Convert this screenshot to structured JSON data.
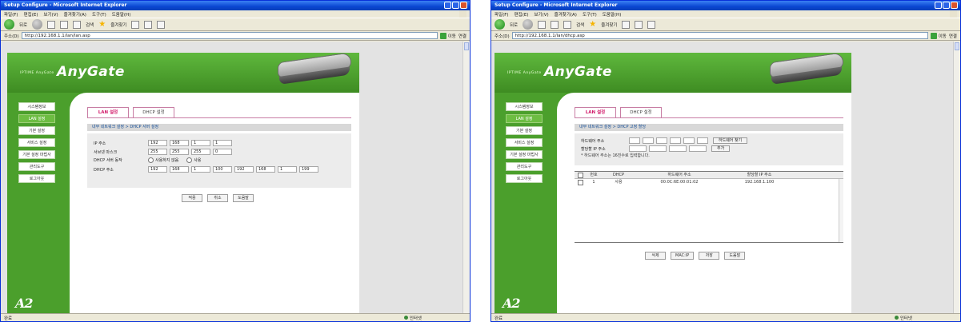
{
  "browser": {
    "title": "Setup Configure - Microsoft Internet Explorer",
    "menu": [
      "파일(F)",
      "편집(E)",
      "보기(V)",
      "즐겨찾기(A)",
      "도구(T)",
      "도움말(H)"
    ],
    "toolbar": {
      "back": "뒤로",
      "search": "검색",
      "favorites": "즐겨찾기"
    },
    "address_label": "주소(D)",
    "go_label": "이동",
    "links_label": "연결",
    "left_url": "http://192.168.1.1/lan/lan.asp",
    "right_url": "http://192.168.1.1/lan/dhcp.asp",
    "status_done": "완료",
    "status_zone": "인터넷"
  },
  "app": {
    "brand_small": "IPTIME AnyGate",
    "brand": "AnyGate",
    "menu": [
      "시스템정보",
      "LAN 설정",
      "기본 설정",
      "서비스 설정",
      "기본 설정 마법사",
      "관리도구",
      "로그아웃"
    ],
    "active_menu_index": 1
  },
  "left_page": {
    "tabs": [
      "LAN 설정",
      "DHCP 설정"
    ],
    "active_tab_index": 0,
    "breadcrumb": "내부 네트워크 설정 > DHCP 서버 설정",
    "fields": [
      {
        "label": "IP 주소",
        "octets": [
          "192",
          "168",
          "1",
          "1"
        ]
      },
      {
        "label": "서브넷 마스크",
        "octets": [
          "255",
          "255",
          "255",
          "0"
        ]
      },
      {
        "label": "DHCP 서버 동작",
        "radio": [
          "사용하지 않음",
          "사용"
        ]
      },
      {
        "label": "DHCP 주소",
        "octets": [
          "192",
          "168",
          "1",
          "100",
          "192",
          "168",
          "1",
          "199"
        ]
      }
    ],
    "buttons": [
      "적용",
      "취소",
      "도움말"
    ]
  },
  "right_page": {
    "tabs": [
      "LAN 설정",
      "DHCP 설정"
    ],
    "active_tab_index": 0,
    "breadcrumb": "내부 네트워크 설정 > DHCP 고정 할당",
    "fields": [
      {
        "label": "하드웨어 주소",
        "octets": [
          "",
          "",
          "",
          "",
          "",
          ""
        ],
        "action": "하드웨어 찾기"
      },
      {
        "label": "할당할 IP 주소",
        "octets": [
          "",
          "",
          "",
          ""
        ],
        "action": "추가"
      }
    ],
    "note": "* 하드웨어 주소는 16진수로 입력합니다.",
    "table": {
      "headers": [
        "",
        "번호",
        "DHCP",
        "하드웨어 주소",
        "할당할 IP 주소"
      ],
      "rows": [
        [
          "",
          "1",
          "사용",
          "00:0C:6E:00:01:02",
          "192.168.1.100"
        ]
      ]
    },
    "buttons": [
      "삭제",
      "MAC:IP",
      "저장",
      "도움말"
    ]
  }
}
